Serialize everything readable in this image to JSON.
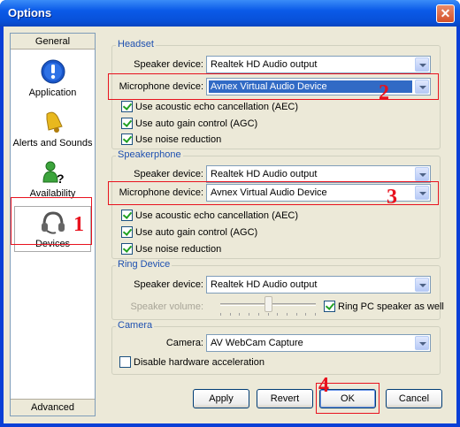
{
  "window": {
    "title": "Options",
    "close_symbol": "✕"
  },
  "sidebar": {
    "header": "General",
    "footer": "Advanced",
    "items": [
      {
        "label": "Application",
        "icon": "info-icon"
      },
      {
        "label": "Alerts and Sounds",
        "icon": "bell-icon"
      },
      {
        "label": "Availability",
        "icon": "user-question-icon"
      },
      {
        "label": "Devices",
        "icon": "headset-icon"
      }
    ]
  },
  "headset": {
    "legend": "Headset",
    "speaker_label": "Speaker device:",
    "speaker_value": "Realtek HD Audio output",
    "mic_label": "Microphone device:",
    "mic_value": "Avnex Virtual Audio Device",
    "aec": "Use acoustic echo cancellation (AEC)",
    "agc": "Use auto gain control (AGC)",
    "noise": "Use noise reduction"
  },
  "speakerphone": {
    "legend": "Speakerphone",
    "speaker_label": "Speaker device:",
    "speaker_value": "Realtek HD Audio output",
    "mic_label": "Microphone device:",
    "mic_value": "Avnex Virtual Audio Device",
    "aec": "Use acoustic echo cancellation (AEC)",
    "agc": "Use auto gain control (AGC)",
    "noise": "Use noise reduction"
  },
  "ring": {
    "legend": "Ring Device",
    "speaker_label": "Speaker device:",
    "speaker_value": "Realtek HD Audio output",
    "volume_label": "Speaker volume:",
    "ring_pc": "Ring PC speaker as well",
    "volume_level": 0.5
  },
  "camera": {
    "legend": "Camera",
    "camera_label": "Camera:",
    "camera_value": "AV WebCam Capture",
    "disable_hw": "Disable hardware acceleration"
  },
  "buttons": {
    "apply": "Apply",
    "revert": "Revert",
    "ok": "OK",
    "cancel": "Cancel"
  },
  "annotations": {
    "n1": "1",
    "n2": "2",
    "n3": "3",
    "n4": "4"
  },
  "colors": {
    "annotation": "#e8121e",
    "legend": "#1e50b0",
    "titlebar": "#0a5ae8"
  }
}
